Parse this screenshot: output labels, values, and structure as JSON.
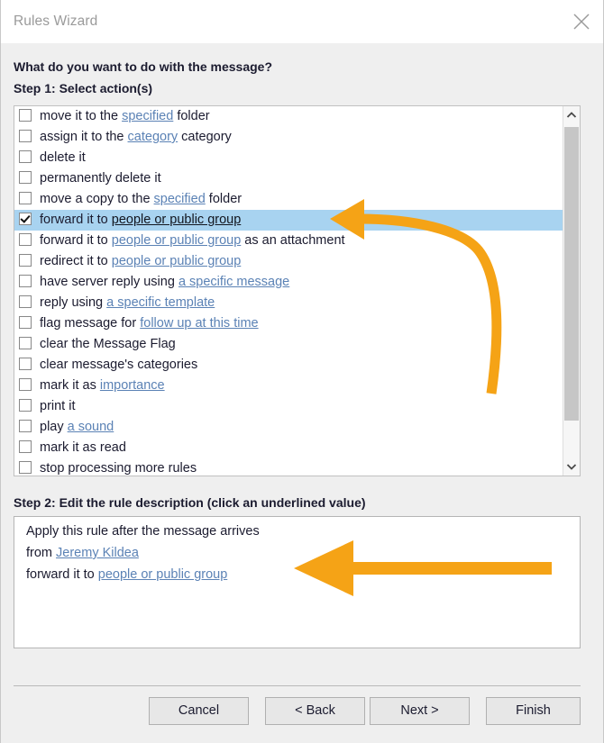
{
  "window": {
    "title": "Rules Wizard",
    "close_icon": "close-icon"
  },
  "prompt": {
    "question": "What do you want to do with the message?",
    "step1": "Step 1: Select action(s)",
    "step2": "Step 2: Edit the rule description (click an underlined value)"
  },
  "actions": [
    {
      "checked": false,
      "parts": [
        {
          "t": "move it to the ",
          "link": false
        },
        {
          "t": "specified",
          "link": true
        },
        {
          "t": " folder",
          "link": false
        }
      ]
    },
    {
      "checked": false,
      "parts": [
        {
          "t": "assign it to the ",
          "link": false
        },
        {
          "t": "category",
          "link": true
        },
        {
          "t": " category",
          "link": false
        }
      ]
    },
    {
      "checked": false,
      "parts": [
        {
          "t": "delete it",
          "link": false
        }
      ]
    },
    {
      "checked": false,
      "parts": [
        {
          "t": "permanently delete it",
          "link": false
        }
      ]
    },
    {
      "checked": false,
      "parts": [
        {
          "t": "move a copy to the ",
          "link": false
        },
        {
          "t": "specified",
          "link": true
        },
        {
          "t": " folder",
          "link": false
        }
      ]
    },
    {
      "checked": true,
      "parts": [
        {
          "t": "forward it to ",
          "link": false
        },
        {
          "t": "people or public group",
          "link": true
        }
      ]
    },
    {
      "checked": false,
      "parts": [
        {
          "t": "forward it to ",
          "link": false
        },
        {
          "t": "people or public group",
          "link": true
        },
        {
          "t": " as an attachment",
          "link": false
        }
      ]
    },
    {
      "checked": false,
      "parts": [
        {
          "t": "redirect it to ",
          "link": false
        },
        {
          "t": "people or public group",
          "link": true
        }
      ]
    },
    {
      "checked": false,
      "parts": [
        {
          "t": "have server reply using ",
          "link": false
        },
        {
          "t": "a specific message",
          "link": true
        }
      ]
    },
    {
      "checked": false,
      "parts": [
        {
          "t": "reply using ",
          "link": false
        },
        {
          "t": "a specific template",
          "link": true
        }
      ]
    },
    {
      "checked": false,
      "parts": [
        {
          "t": "flag message for ",
          "link": false
        },
        {
          "t": "follow up at this time",
          "link": true
        }
      ]
    },
    {
      "checked": false,
      "parts": [
        {
          "t": "clear the Message Flag",
          "link": false
        }
      ]
    },
    {
      "checked": false,
      "parts": [
        {
          "t": "clear message's categories",
          "link": false
        }
      ]
    },
    {
      "checked": false,
      "parts": [
        {
          "t": "mark it as ",
          "link": false
        },
        {
          "t": "importance",
          "link": true
        }
      ]
    },
    {
      "checked": false,
      "parts": [
        {
          "t": "print it",
          "link": false
        }
      ]
    },
    {
      "checked": false,
      "parts": [
        {
          "t": "play ",
          "link": false
        },
        {
          "t": "a sound",
          "link": true
        }
      ]
    },
    {
      "checked": false,
      "parts": [
        {
          "t": "mark it as read",
          "link": false
        }
      ]
    },
    {
      "checked": false,
      "parts": [
        {
          "t": "stop processing more rules",
          "link": false
        }
      ]
    }
  ],
  "scrollbar": {
    "up_icon": "chevron-up-icon",
    "down_icon": "chevron-down-icon"
  },
  "description": [
    {
      "parts": [
        {
          "t": "Apply this rule after the message arrives",
          "link": false
        }
      ]
    },
    {
      "parts": [
        {
          "t": "from ",
          "link": false
        },
        {
          "t": "Jeremy Kildea",
          "link": true
        }
      ]
    },
    {
      "parts": [
        {
          "t": "forward it to ",
          "link": false
        },
        {
          "t": "people or public group",
          "link": true
        }
      ]
    }
  ],
  "buttons": {
    "cancel": "Cancel",
    "back": "< Back",
    "next": "Next >",
    "finish": "Finish"
  },
  "annotations": {
    "color": "#f5a316",
    "curved_arrow": "curved-arrow-pointing-to-selected-action",
    "straight_arrow": "straight-arrow-pointing-to-forward-link"
  }
}
